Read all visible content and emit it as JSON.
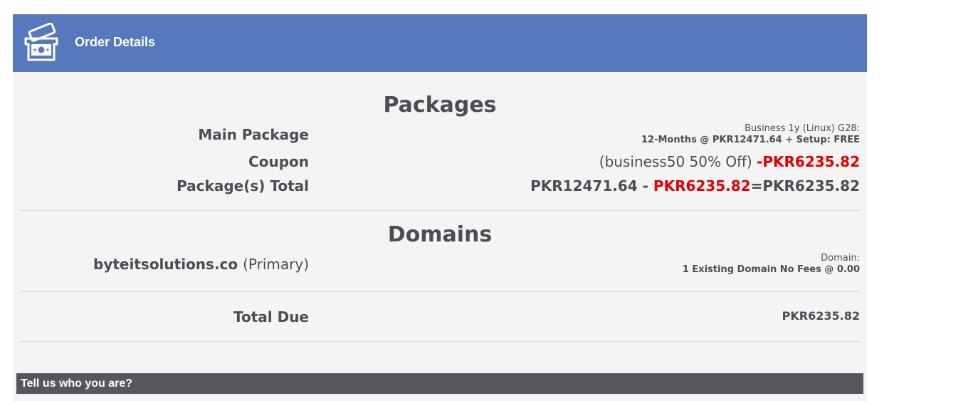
{
  "header": {
    "title": "Order Details",
    "icon": "money-icon"
  },
  "packages": {
    "section_title": "Packages",
    "main_package": {
      "label": "Main Package",
      "line1": "Business 1y (Linux) G28:",
      "line2": "12-Months @ PKR12471.64 + Setup: FREE"
    },
    "coupon": {
      "label": "Coupon",
      "description": "(business50 50% Off)",
      "discount": "-PKR6235.82"
    },
    "total": {
      "label": "Package(s) Total",
      "subtotal": "PKR12471.64 - ",
      "discount": "PKR6235.82",
      "result": "=PKR6235.82"
    }
  },
  "domains": {
    "section_title": "Domains",
    "items": [
      {
        "name": "byteitsolutions.co",
        "tag": "(Primary)",
        "line1": "Domain:",
        "line2": "1 Existing Domain No Fees @ 0.00"
      }
    ]
  },
  "total_due": {
    "label": "Total Due",
    "value": "PKR6235.82"
  },
  "next_section": {
    "title": "Tell us who you are?"
  },
  "colors": {
    "header_bg": "#5579bc",
    "panel_bg": "#f4f4f4",
    "text": "#4a4d52",
    "discount_red": "#e00000",
    "bar_bg": "#54575b"
  }
}
